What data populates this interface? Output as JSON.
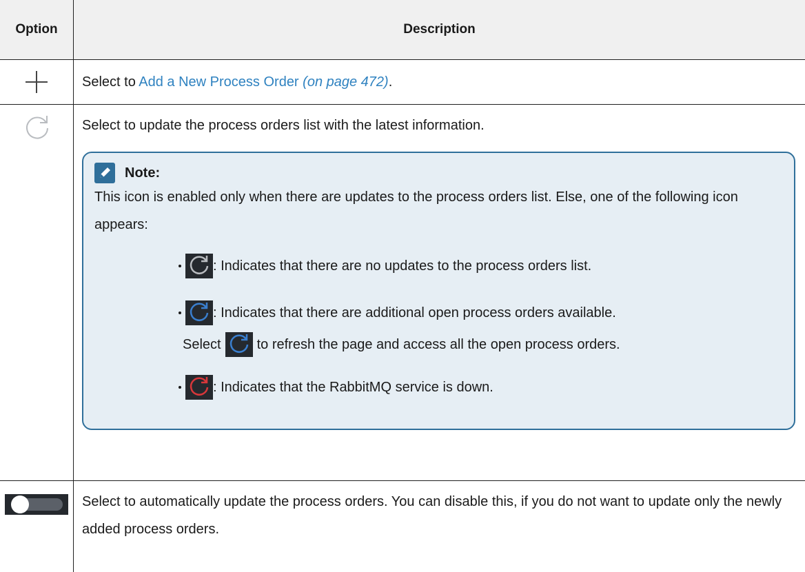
{
  "table": {
    "headers": {
      "option": "Option",
      "description": "Description"
    },
    "rows": [
      {
        "icon": "plus-icon",
        "text_before": "Select to ",
        "link_text": "Add a New Process Order",
        "page_ref": "(on page 472)",
        "text_after": "."
      },
      {
        "icon": "refresh-icon",
        "text": "Select to update the process orders list with the latest information.",
        "note": {
          "title": "Note:",
          "body": "This icon is enabled only when there are updates to the process orders list. Else, one of the following icon appears:",
          "items": [
            {
              "icon": "refresh-grey-icon",
              "text": ": Indicates that there are no updates to the process orders list."
            },
            {
              "icon": "refresh-blue-icon",
              "text": ": Indicates that there are additional open process orders available."
            },
            {
              "icon": "refresh-red-icon",
              "text": ": Indicates that the RabbitMQ service is down."
            }
          ],
          "sub_line": {
            "before": "Select",
            "after": "to refresh the page and access all the open process orders."
          }
        }
      },
      {
        "icon": "toggle-icon",
        "text": "Select to automatically update the process orders. You can disable this, if you do not want to update only the newly added process orders."
      }
    ]
  },
  "colors": {
    "link": "#2f82c0",
    "note_border": "#2f6f9a",
    "note_background": "#e6eef4",
    "refresh_grey": "#b9bcc0",
    "refresh_blue": "#3a7fcf",
    "refresh_red": "#d8373a"
  }
}
